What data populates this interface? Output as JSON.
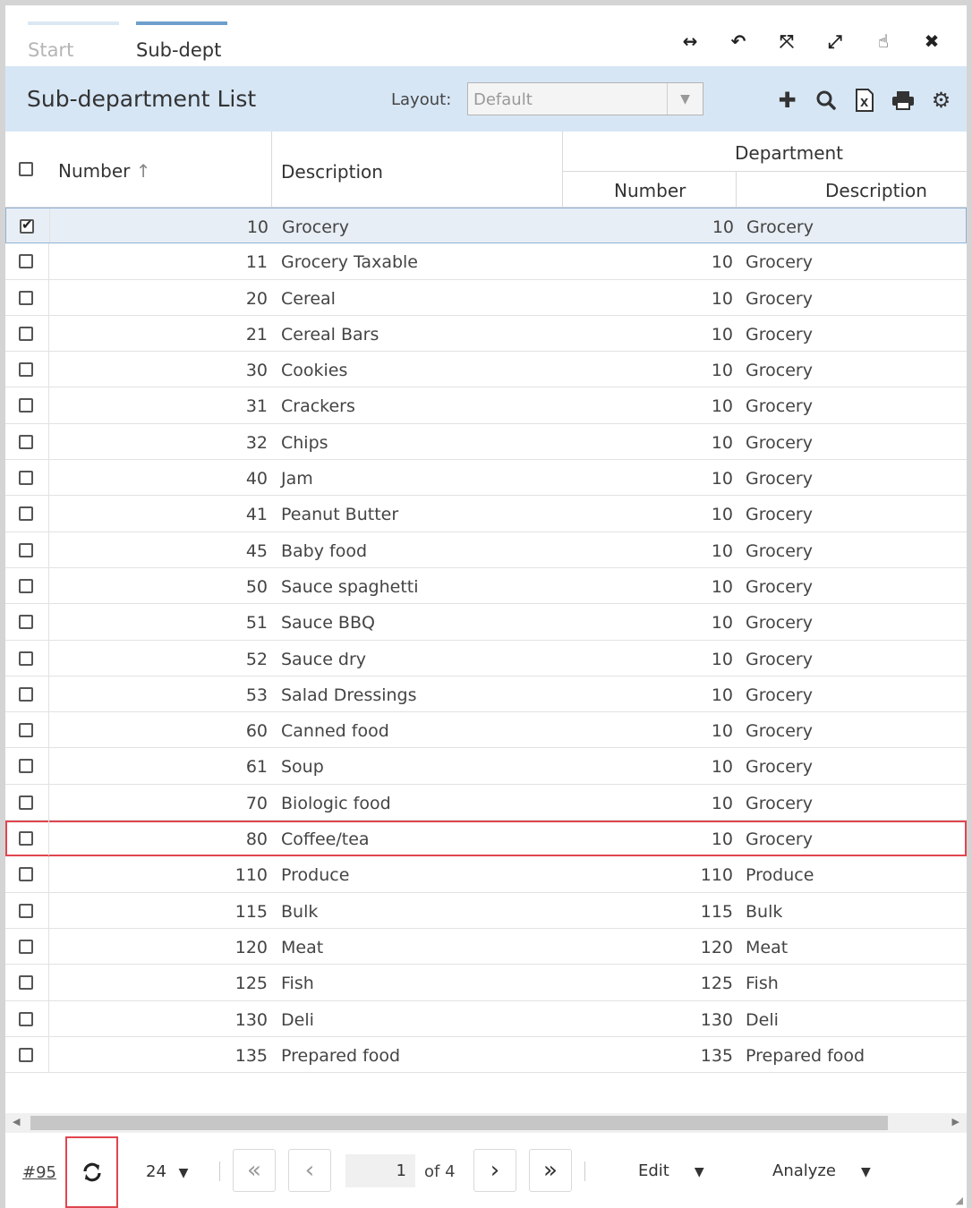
{
  "tabs": {
    "start": "Start",
    "sub": "Sub-dept"
  },
  "window_icons": [
    "arrows-horizontal-icon",
    "undo-icon",
    "compress-icon",
    "expand-icon",
    "pointer-icon",
    "close-icon"
  ],
  "header": {
    "title": "Sub-department List",
    "layout_label": "Layout:",
    "layout_value": "Default",
    "icons": [
      "plus-icon",
      "search-icon",
      "excel-icon",
      "print-icon",
      "settings-icon"
    ]
  },
  "table": {
    "col_number": "Number",
    "col_description": "Description",
    "group_department": "Department",
    "col_dept_number": "Number",
    "col_dept_description": "Description",
    "rows": [
      {
        "num": "10",
        "desc": "Grocery",
        "dnum": "10",
        "ddesc": "Grocery",
        "checked": true
      },
      {
        "num": "11",
        "desc": "Grocery Taxable",
        "dnum": "10",
        "ddesc": "Grocery"
      },
      {
        "num": "20",
        "desc": "Cereal",
        "dnum": "10",
        "ddesc": "Grocery"
      },
      {
        "num": "21",
        "desc": "Cereal Bars",
        "dnum": "10",
        "ddesc": "Grocery"
      },
      {
        "num": "30",
        "desc": "Cookies",
        "dnum": "10",
        "ddesc": "Grocery"
      },
      {
        "num": "31",
        "desc": "Crackers",
        "dnum": "10",
        "ddesc": "Grocery"
      },
      {
        "num": "32",
        "desc": "Chips",
        "dnum": "10",
        "ddesc": "Grocery"
      },
      {
        "num": "40",
        "desc": "Jam",
        "dnum": "10",
        "ddesc": "Grocery"
      },
      {
        "num": "41",
        "desc": "Peanut Butter",
        "dnum": "10",
        "ddesc": "Grocery"
      },
      {
        "num": "45",
        "desc": "Baby food",
        "dnum": "10",
        "ddesc": "Grocery"
      },
      {
        "num": "50",
        "desc": "Sauce spaghetti",
        "dnum": "10",
        "ddesc": "Grocery"
      },
      {
        "num": "51",
        "desc": "Sauce BBQ",
        "dnum": "10",
        "ddesc": "Grocery"
      },
      {
        "num": "52",
        "desc": "Sauce dry",
        "dnum": "10",
        "ddesc": "Grocery"
      },
      {
        "num": "53",
        "desc": "Salad Dressings",
        "dnum": "10",
        "ddesc": "Grocery"
      },
      {
        "num": "60",
        "desc": "Canned food",
        "dnum": "10",
        "ddesc": "Grocery"
      },
      {
        "num": "61",
        "desc": "Soup",
        "dnum": "10",
        "ddesc": "Grocery"
      },
      {
        "num": "70",
        "desc": "Biologic food",
        "dnum": "10",
        "ddesc": "Grocery"
      },
      {
        "num": "80",
        "desc": "Coffee/tea",
        "dnum": "10",
        "ddesc": "Grocery",
        "highlight": true
      },
      {
        "num": "110",
        "desc": "Produce",
        "dnum": "110",
        "ddesc": "Produce"
      },
      {
        "num": "115",
        "desc": "Bulk",
        "dnum": "115",
        "ddesc": "Bulk"
      },
      {
        "num": "120",
        "desc": "Meat",
        "dnum": "120",
        "ddesc": "Meat"
      },
      {
        "num": "125",
        "desc": "Fish",
        "dnum": "125",
        "ddesc": "Fish"
      },
      {
        "num": "130",
        "desc": "Deli",
        "dnum": "130",
        "ddesc": "Deli"
      },
      {
        "num": "135",
        "desc": "Prepared food",
        "dnum": "135",
        "ddesc": "Prepared food"
      }
    ]
  },
  "footer": {
    "record_count": "#95",
    "page_size": "24",
    "page": "1",
    "of_pages": "of 4",
    "edit": "Edit",
    "analyze": "Analyze"
  }
}
